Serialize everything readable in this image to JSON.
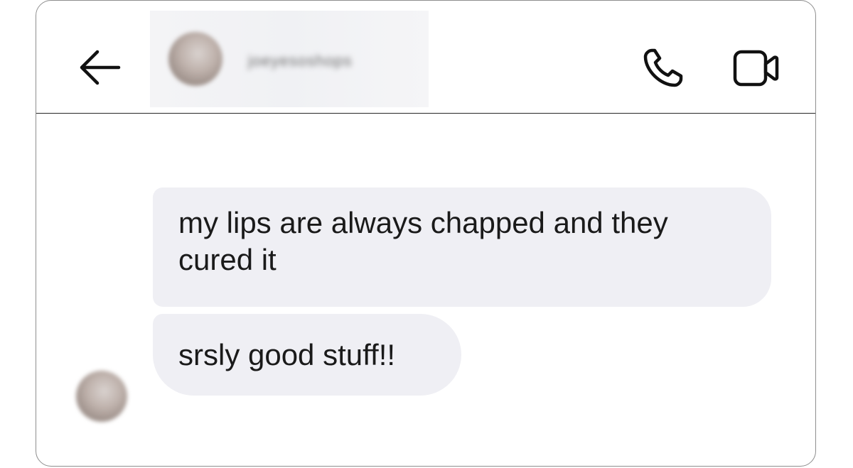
{
  "header": {
    "username": "joeyesoshops",
    "back_icon": "arrow-left-icon",
    "call_icon": "phone-icon",
    "video_icon": "video-camera-icon"
  },
  "messages": [
    {
      "text": "my lips are always chapped and they cured it"
    },
    {
      "text": "srsly good stuff!!"
    }
  ],
  "colors": {
    "bubble_bg": "#efeff4",
    "text": "#1a1a1a",
    "divider": "#262626",
    "frame_border": "#8e8e8e"
  }
}
